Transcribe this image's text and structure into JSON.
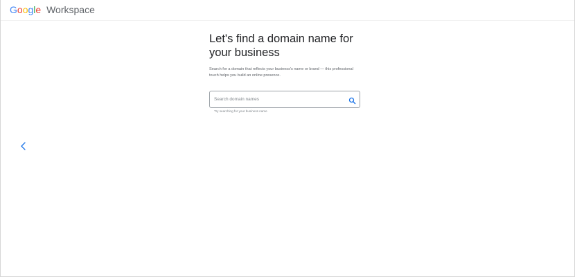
{
  "header": {
    "logo_letters": [
      "G",
      "o",
      "o",
      "g",
      "l",
      "e"
    ],
    "logo_colors": [
      "#4285f4",
      "#ea4335",
      "#fbbc05",
      "#4285f4",
      "#34a853",
      "#ea4335"
    ],
    "product_name": "Workspace"
  },
  "main": {
    "headline": "Let's find a domain name for your business",
    "description": "Search for a domain that reflects your business's name or brand — this professional touch helps you build an online presence.",
    "search": {
      "placeholder": "Search domain names",
      "value": "",
      "icon": "search-icon",
      "hint": "Try searching for your business name"
    }
  },
  "navigation": {
    "back_icon": "chevron-left-icon",
    "accent_color": "#1a73e8"
  }
}
